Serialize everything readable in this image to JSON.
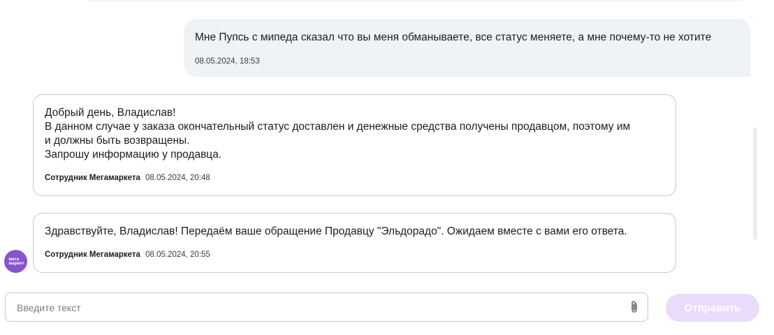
{
  "messages": {
    "user": {
      "text": "Мне Пупсь с мипеда сказал что вы меня обманываете, все статус меняете, а мне почему-то не хотите",
      "time": "08.05.2024, 18:53"
    },
    "operator": [
      {
        "lines": [
          "Добрый день, Владислав!",
          "В данном случае у заказа окончательный статус доставлен и денежные средства получены продавцом, поэтому им",
          "и должны быть возвращены.",
          "Запрошу информацию у продавца."
        ],
        "author": "Сотрудник Мегамаркета",
        "time": "08.05.2024, 20:48"
      },
      {
        "lines": [
          "Здравствуйте, Владислав! Передаём ваше обращение Продавцу \"Эльдорадо\". Ожидаем вместе с вами его ответа."
        ],
        "author": "Сотрудник Мегамаркета",
        "time": "08.05.2024, 20:55"
      }
    ]
  },
  "avatar": {
    "line1": "мега",
    "line2": "маркет",
    "color": "#8654cc"
  },
  "composer": {
    "placeholder": "Введите текст",
    "value": "",
    "attach_icon": "paperclip-icon",
    "send_label": "Отправить"
  },
  "colors": {
    "accent": "#8654cc",
    "send_disabled_bg": "#e8dcfa",
    "user_bubble_bg": "#f0f3f6"
  }
}
